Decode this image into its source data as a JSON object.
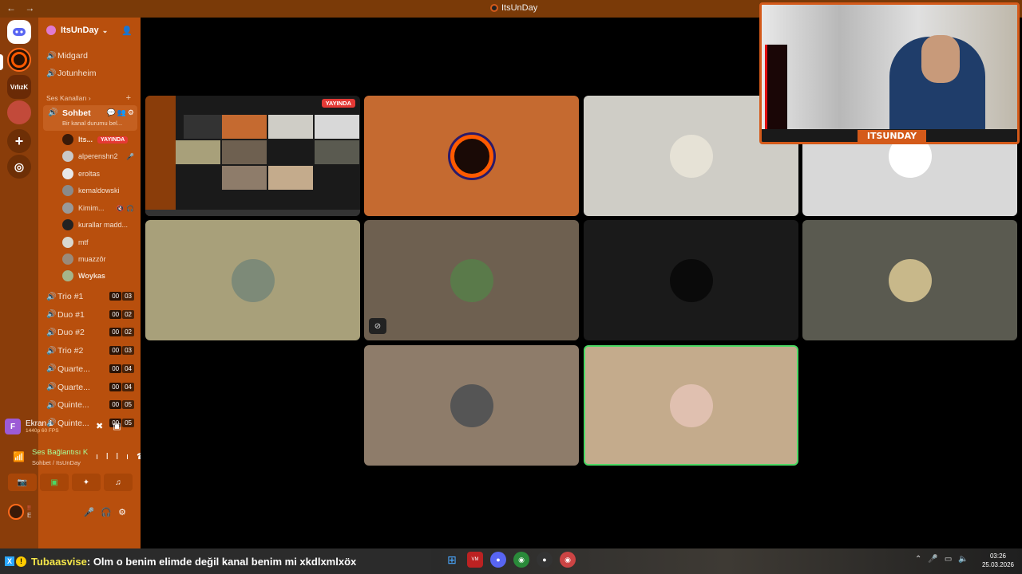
{
  "window": {
    "title": "ItsUnDay",
    "back": "←",
    "forward": "→"
  },
  "guilds": {
    "home": "discord",
    "vifizk": "VıfızK",
    "add": "+",
    "explore": "compass"
  },
  "server": {
    "name": "ItsUnDay"
  },
  "text_channels": [
    "Midgard",
    "Jotunheim"
  ],
  "category": "Ses Kanalları",
  "active_channel": {
    "name": "Sohbet",
    "status": "Bir kanal durumu bel..."
  },
  "members": [
    {
      "name": "Its...",
      "live": "YAYINDA",
      "color": "#3a1a08"
    },
    {
      "name": "alperenshn2",
      "extra": "🎤",
      "color": "#c9c9c9"
    },
    {
      "name": "eroltas",
      "extra": "",
      "color": "#e8e8e8"
    },
    {
      "name": "kemaldowski",
      "extra": "",
      "color": "#8a8a8a"
    },
    {
      "name": "Kimim...",
      "extra": "🔇 🎧",
      "color": "#999"
    },
    {
      "name": "kurallar madd...",
      "extra": "",
      "color": "#222"
    },
    {
      "name": "mtf",
      "extra": "",
      "color": "#d8d8d0"
    },
    {
      "name": "muazzôr",
      "extra": "",
      "color": "#9a8a7a"
    },
    {
      "name": "Woykas",
      "extra": "",
      "color": "#a5b58a"
    }
  ],
  "voice_channels": [
    {
      "name": "Trio #1",
      "a": "00",
      "b": "03"
    },
    {
      "name": "Duo #1",
      "a": "00",
      "b": "02"
    },
    {
      "name": "Duo #2",
      "a": "00",
      "b": "02"
    },
    {
      "name": "Trio #2",
      "a": "00",
      "b": "03"
    },
    {
      "name": "Quarte...",
      "a": "00",
      "b": "04"
    },
    {
      "name": "Quarte...",
      "a": "00",
      "b": "04"
    },
    {
      "name": "Quinte...",
      "a": "00",
      "b": "05"
    },
    {
      "name": "Quinte...",
      "a": "00",
      "b": "05"
    }
  ],
  "screen_share": {
    "badge": "F",
    "title": "Ekran 1",
    "quality": "1440p 60 FPS"
  },
  "voice_connection": {
    "status": "Ses Bağlantısı K",
    "location": "Sohbet / ItsUnDay"
  },
  "user": {
    "name": "!!",
    "sub": "E"
  },
  "stage": {
    "stream_live_label": "YAYINDA",
    "tiles": [
      {
        "id": "stream",
        "bg": "#1a1a1a"
      },
      {
        "id": "itsunday",
        "bg": "#c56a30",
        "pfp": "#1a0a06"
      },
      {
        "id": "cartoon",
        "bg": "#cfcdc6",
        "pfp": "#e6e2d6"
      },
      {
        "id": "anime-white",
        "bg": "#d8d8d8",
        "pfp": "#ffffff"
      },
      {
        "id": "olive",
        "bg": "#a8a07a",
        "pfp": "#7d8a78"
      },
      {
        "id": "brown",
        "bg": "#6e6050",
        "pfp": "#5a7a4a",
        "muted": true
      },
      {
        "id": "dark",
        "bg": "#1a1a1a",
        "pfp": "#0a0a0a"
      },
      {
        "id": "grey",
        "bg": "#5a5a50",
        "pfp": "#c8b88a"
      },
      {
        "id": "taupe",
        "bg": "#8e7c6a",
        "pfp": "#555"
      },
      {
        "id": "beige",
        "bg": "#c4ab8c",
        "pfp": "#e0c0b0",
        "selected": true
      }
    ]
  },
  "webcam": {
    "banner": "ITSUNDAY"
  },
  "ticker": {
    "nick": "Tubaasvise",
    "message": " : Olm o benim elimde değil kanal benim mi xkdlxmlxöx"
  },
  "clock": {
    "time": "03:26",
    "date": "25.03.2026"
  },
  "colors": {
    "accent": "#d45a1a",
    "sidebar": "#b84f0d",
    "live": "#e53935"
  }
}
